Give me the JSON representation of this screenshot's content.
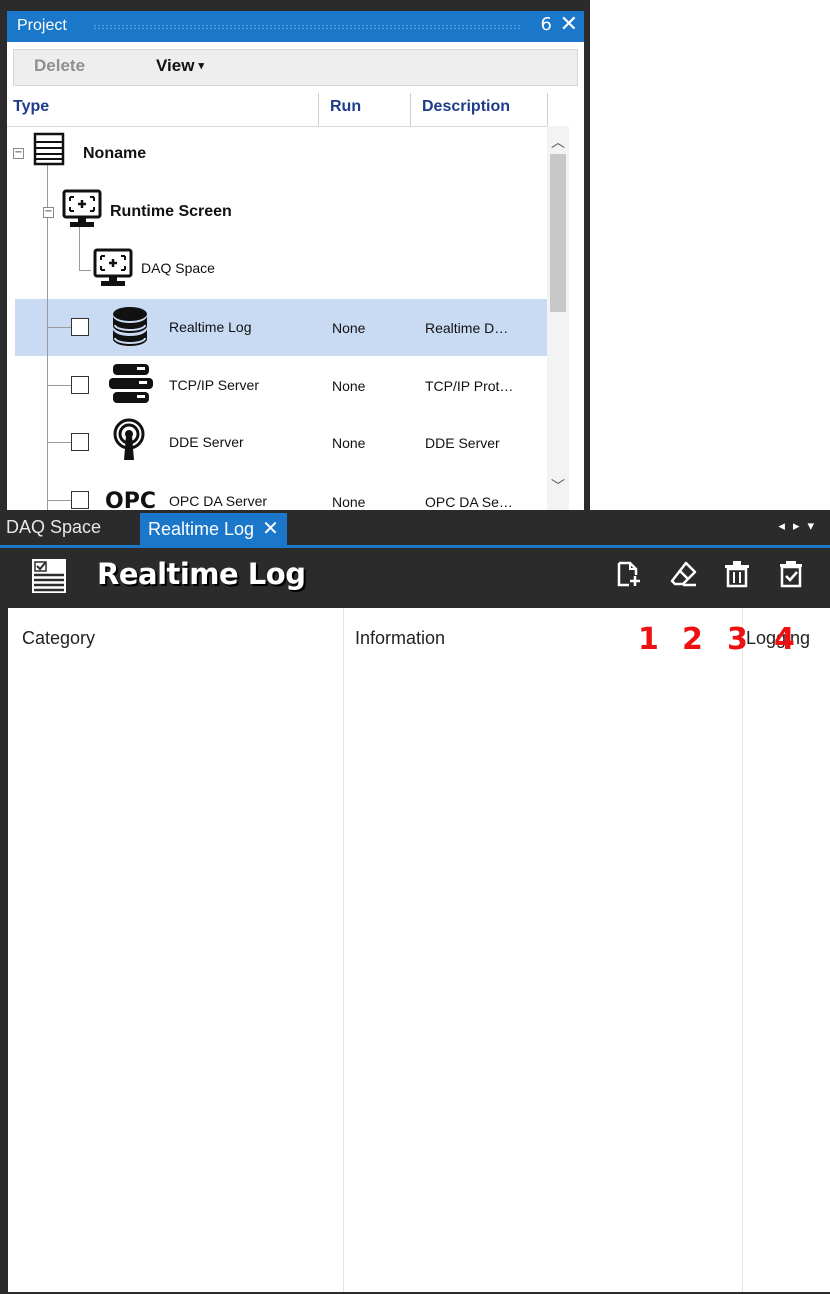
{
  "project_panel": {
    "title": "Project",
    "toolbar": {
      "delete_label": "Delete",
      "view_label": "View"
    },
    "columns": {
      "type": "Type",
      "run": "Run",
      "description": "Description"
    },
    "tree": {
      "root": "Noname",
      "runtime_screen": "Runtime Screen",
      "daq_space": "DAQ Space",
      "items": [
        {
          "label": "Realtime Log",
          "run": "None",
          "description": "Realtime D…"
        },
        {
          "label": "TCP/IP Server",
          "run": "None",
          "description": "TCP/IP Prot…"
        },
        {
          "label": "DDE Server",
          "run": "None",
          "description": "DDE Server"
        },
        {
          "label": "OPC DA Server",
          "run": "None",
          "description": "OPC DA Se…"
        }
      ]
    }
  },
  "tabs": {
    "daq_space": "DAQ Space",
    "realtime_log": "Realtime Log"
  },
  "document": {
    "title": "Realtime Log",
    "columns": {
      "category": "Category",
      "information": "Information",
      "logging": "Logging"
    },
    "annotations": [
      "1",
      "2",
      "3",
      "4"
    ]
  },
  "icons": {
    "pin": "pin-icon",
    "close": "close-icon",
    "add_document": "add-document-icon",
    "edit": "eraser-edit-icon",
    "delete": "trash-icon",
    "check": "clipboard-check-icon"
  },
  "colors": {
    "accent": "#1a77c9",
    "dark": "#2b2b2b",
    "selection": "#c9dbf3",
    "annotation": "#ee1111"
  }
}
